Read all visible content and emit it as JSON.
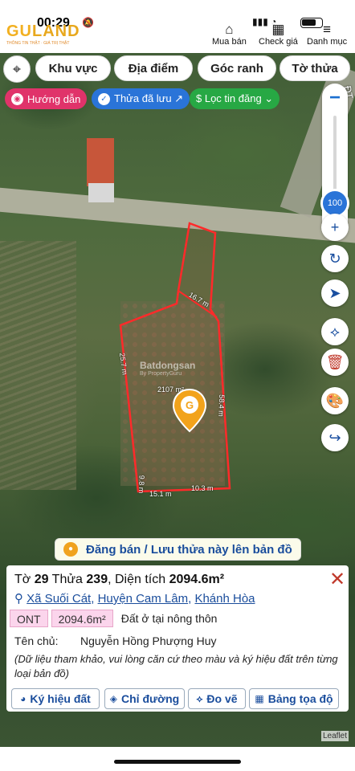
{
  "status": {
    "time": "00:29",
    "bell_icon": "bell-muted-icon"
  },
  "brand": {
    "logo_gu": "GU",
    "logo_land": "LAND",
    "tagline": "THÔNG TIN THẬT · GIÁ TRỊ THẬT"
  },
  "header_nav": [
    {
      "label": "Mua bán",
      "icon": "house-icon"
    },
    {
      "label": "Check giá",
      "icon": "price-check-icon"
    },
    {
      "label": "Danh mục",
      "icon": "menu-icon"
    }
  ],
  "filter_chips": [
    "Khu vực",
    "Địa điểm",
    "Góc ranh",
    "Tờ thửa"
  ],
  "pills": {
    "guide": "Hướng dẫn",
    "saved": "Thửa đã lưu ↗",
    "filter": "$ Lọc tin đăng ⌄"
  },
  "colors": {
    "guide": "#e0336a",
    "saved": "#2a74d8",
    "filter": "#27a844",
    "parcel_border": "#ff2a2a"
  },
  "map": {
    "zoom_level": "100",
    "edges": [
      "16.7 m",
      "25.7 m",
      "58.4 m",
      "9.8 m",
      "15.1 m",
      "10.3 m"
    ],
    "area_label": "2107 m²",
    "watermark": "Batdongsan",
    "watermark_sub": "By PropertyGuru",
    "street_label": "ĐT NH",
    "attribution": "Leaflet"
  },
  "cta_label": "Đăng bán / Lưu thửa này lên bản đồ",
  "parcel": {
    "sheet_label": "Tờ ",
    "sheet": "29",
    "lot_label": " Thửa ",
    "lot": "239",
    "area_text": ", Diện tích ",
    "area": "2094.6m²",
    "ward": "Xã Suối Cát",
    "district": "Huyện Cam Lâm",
    "province": "Khánh Hòa",
    "land_code": "ONT",
    "land_area": "2094.6m²",
    "land_desc": "Đất ở tại nông thôn",
    "owner_label": "Tên chủ:",
    "owner": "Nguyễn Hồng Phượng Huy",
    "note": "(Dữ liệu tham khảo, vui lòng căn cứ theo màu và ký hiệu đất trên từng loại bản đồ)"
  },
  "actions": [
    "Ký hiệu đất",
    "Chỉ đường",
    "Đo vẽ",
    "Bảng tọa độ"
  ]
}
